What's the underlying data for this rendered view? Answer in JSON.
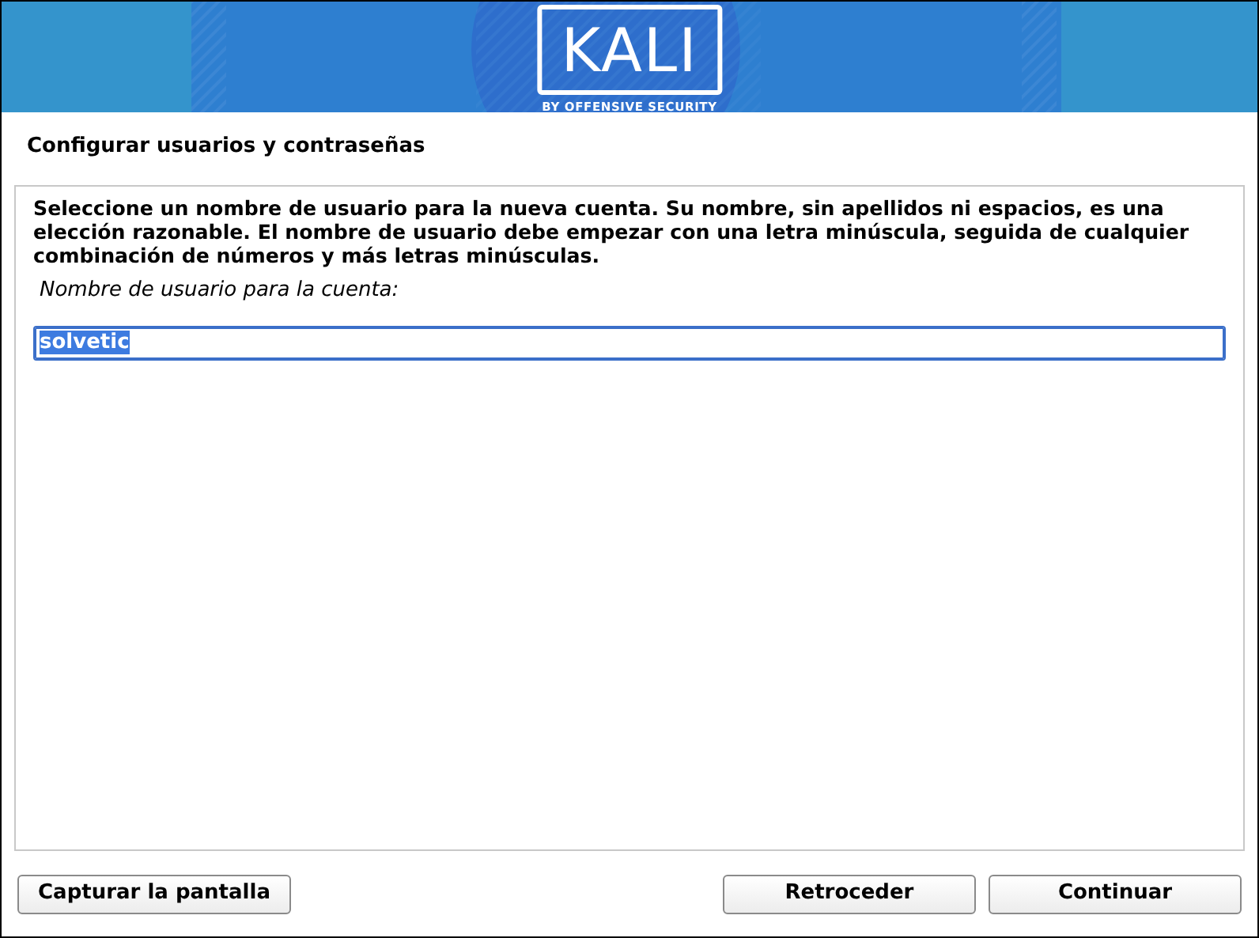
{
  "banner": {
    "logo_text": "KALI",
    "tagline": "BY OFFENSIVE SECURITY"
  },
  "title": "Configurar usuarios y contraseñas",
  "description": "Seleccione un nombre de usuario para la nueva cuenta. Su nombre, sin apellidos ni espacios, es una elección razonable. El nombre de usuario debe empezar con una letra minúscula, seguida de cualquier combinación de números y más letras minúsculas.",
  "field": {
    "label": "Nombre de usuario para la cuenta:",
    "value": "solvetic",
    "value_selected": true,
    "focused": true
  },
  "buttons": [
    {
      "label": "Capturar la pantalla",
      "kind": "left"
    },
    {
      "label": "Retroceder",
      "kind": "right"
    },
    {
      "label": "Continuar",
      "kind": "right"
    }
  ]
}
